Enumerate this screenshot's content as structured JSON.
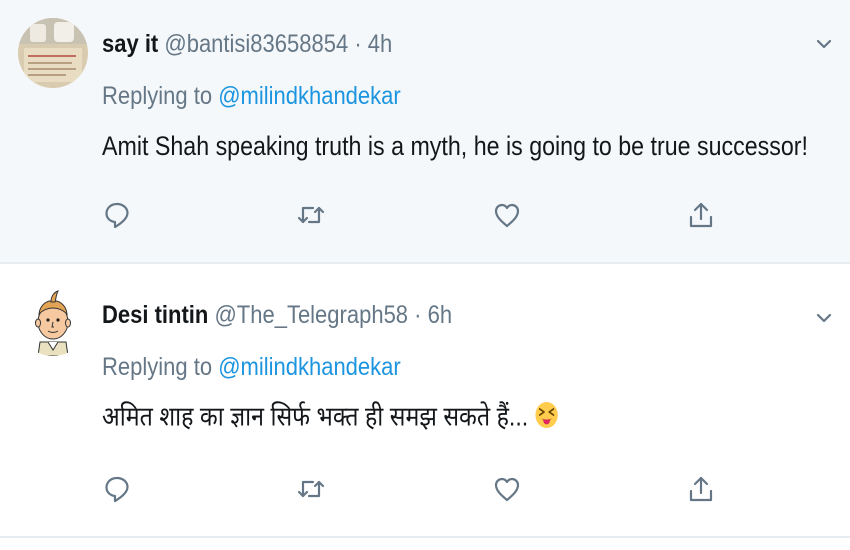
{
  "tweets": [
    {
      "display_name": "say it",
      "handle": "@bantisi83658854",
      "separator": "·",
      "time": "4h",
      "replying_prefix": "Replying to",
      "replying_to": "@milindkhandekar",
      "text": "Amit Shah speaking truth is a myth, he is going to be true successor!",
      "avatar_icon": "photo-avatar",
      "emoji": ""
    },
    {
      "display_name": "Desi tintin",
      "handle": "@The_Telegraph58",
      "separator": "·",
      "time": "6h",
      "replying_prefix": "Replying to",
      "replying_to": "@milindkhandekar",
      "text": "अमित शाह का ज्ञान सिर्फ भक्त ही समझ सकते हैं...",
      "avatar_icon": "tintin-cartoon-avatar",
      "emoji": "squinting-face-with-tongue"
    }
  ],
  "actions": [
    "reply-icon",
    "retweet-icon",
    "like-icon",
    "share-icon"
  ],
  "colors": {
    "name": "#14171a",
    "secondary": "#657786",
    "link": "#1b95e0",
    "highlight_bg": "#f5f8fa",
    "divider": "#e6ecf0"
  }
}
